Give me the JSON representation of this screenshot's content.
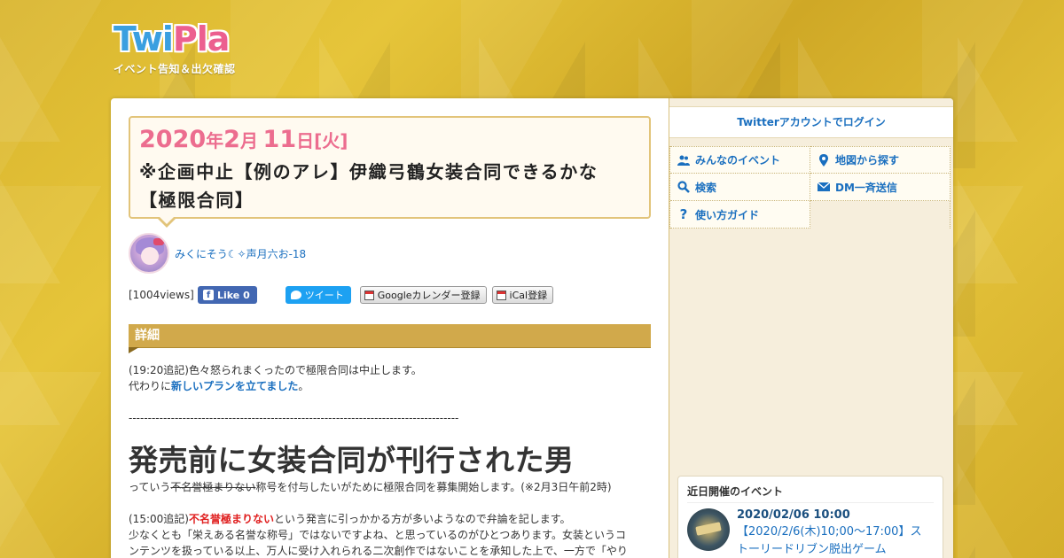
{
  "brand": {
    "logo_part1": "Twi",
    "logo_part2": "Pla",
    "tagline": "イベント告知＆出欠確認",
    "colors": {
      "twi": "#3a9fe0",
      "pla": "#ec5f8f",
      "accent": "#d1a94b",
      "link": "#1a6fbf",
      "date": "#ec6d8f"
    }
  },
  "event": {
    "year": "2020",
    "year_suffix": "年",
    "month": "2",
    "month_suffix": "月",
    "day": "11",
    "day_suffix": "日",
    "weekday": "[火]",
    "title_line1": "※企画中止【例のアレ】伊織弓鶴女装合同できるかな",
    "title_line2": "【極限合同】"
  },
  "organizer": {
    "name": "みくにそう☾✧声月六お-18",
    "avatar_icon": "user-avatar"
  },
  "share": {
    "views": "[1004views]",
    "fb_label": "Like 0",
    "tw_label": "ツイート",
    "gcal_label": "Googleカレンダー登録",
    "ical_label": "iCal登録"
  },
  "details": {
    "header": "詳細",
    "line1": "(19:20追記)色々怒られまくったので極限合同は中止します。",
    "line2_prefix": "代わりに",
    "line2_link": "新しいプランを立てました",
    "line2_suffix": "。",
    "dashes": "--------------------------------------------------------------------------------------",
    "big_heading": "発売前に女装合同が刊行された男",
    "line3_prefix": "っていう",
    "line3_strike": "不名誉極まりない",
    "line3_suffix": "称号を付与したいがために極限合同を募集開始します。(※2月3日午前2時)",
    "line4_prefix": "(15:00追記)",
    "line4_red": "不名誉極まりない",
    "line4_suffix": "という発言に引っかかる方が多いようなので弁論を記します。",
    "line5": "少なくとも「栄えある名誉な称号」ではないですよね、と思っているのがひとつあります。女装というコ",
    "line6": "ンテンツを扱っている以上、万人に受け入れられる二次創作ではないことを承知した上で、一方で「やり"
  },
  "sidebar": {
    "login": "Twitterアカウントでログイン",
    "nav": [
      {
        "label": "みんなのイベント",
        "icon": "users-icon"
      },
      {
        "label": "地図から探す",
        "icon": "map-pin-icon"
      },
      {
        "label": "検索",
        "icon": "search-icon"
      },
      {
        "label": "DM一斉送信",
        "icon": "mail-icon"
      },
      {
        "label": "使い方ガイド",
        "icon": "help-icon"
      }
    ],
    "upcoming": {
      "title": "近日開催のイベント",
      "event_date": "2020/02/06 10:00",
      "event_name_line1": "【2020/2/6(木)10;00〜17:00】ス",
      "event_name_line2": "トーリードリブン脱出ゲーム"
    }
  }
}
